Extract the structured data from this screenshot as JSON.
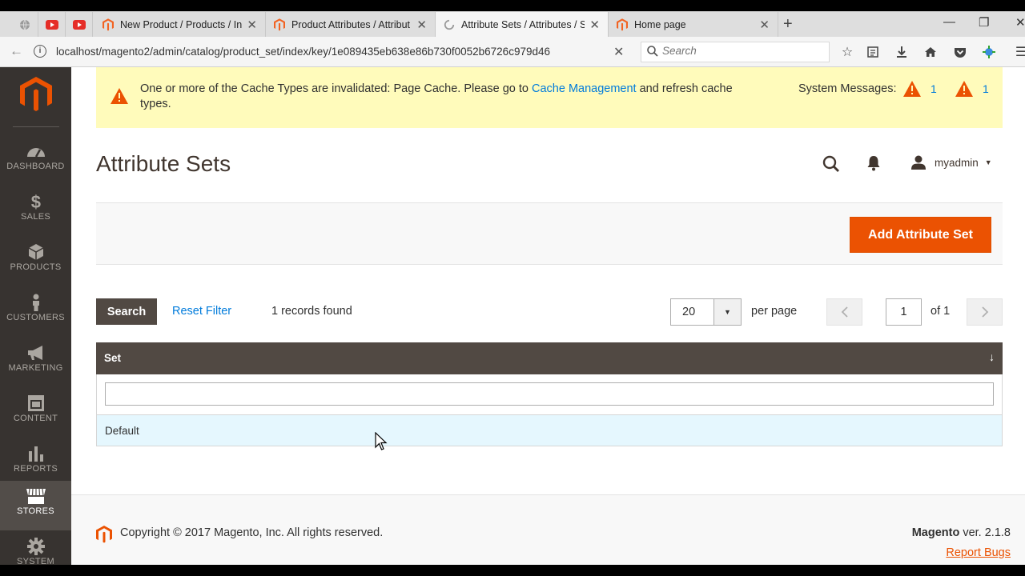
{
  "browser": {
    "tabs": [
      {
        "title": "New Product / Products / In",
        "active": false
      },
      {
        "title": "Product Attributes / Attribut",
        "active": false
      },
      {
        "title": "Attribute Sets / Attributes / S",
        "active": true
      },
      {
        "title": "Home page",
        "active": false
      }
    ],
    "url": "localhost/magento2/admin/catalog/product_set/index/key/1e089435eb638e86b730f0052b6726c979d46",
    "search_placeholder": "Search"
  },
  "sidebar": {
    "items": [
      {
        "label": "DASHBOARD",
        "icon": "dashboard-icon"
      },
      {
        "label": "SALES",
        "icon": "dollar-icon"
      },
      {
        "label": "PRODUCTS",
        "icon": "cube-icon"
      },
      {
        "label": "CUSTOMERS",
        "icon": "person-icon"
      },
      {
        "label": "MARKETING",
        "icon": "megaphone-icon"
      },
      {
        "label": "CONTENT",
        "icon": "layout-icon"
      },
      {
        "label": "REPORTS",
        "icon": "bar-chart-icon"
      },
      {
        "label": "STORES",
        "icon": "store-icon",
        "active": true
      },
      {
        "label": "SYSTEM",
        "icon": "gear-icon"
      }
    ]
  },
  "notice": {
    "text_before": "One or more of the Cache Types are invalidated: Page Cache. Please go to ",
    "link": "Cache Management",
    "text_after": " and refresh cache types.",
    "system_messages_label": "System Messages:",
    "count_a": "1",
    "count_b": "1",
    "warning_color": "#eb5202"
  },
  "header": {
    "page_title": "Attribute Sets",
    "username": "myadmin"
  },
  "actions": {
    "add_label": "Add Attribute Set"
  },
  "grid_controls": {
    "search_label": "Search",
    "reset_label": "Reset Filter",
    "records_text": "1 records found",
    "per_page_value": "20",
    "per_page_label": "per page",
    "current_page": "1",
    "of_pages": "of 1"
  },
  "grid": {
    "columns": [
      "Set"
    ],
    "rows": [
      [
        "Default"
      ]
    ]
  },
  "footer": {
    "copyright": "Copyright © 2017 Magento, Inc. All rights reserved.",
    "brand": "Magento",
    "version": " ver. 2.1.8",
    "report_bugs": "Report Bugs"
  },
  "colors": {
    "accent": "#eb5202",
    "sidebar_bg": "#373330",
    "grid_header": "#514943",
    "link": "#007bdb"
  }
}
